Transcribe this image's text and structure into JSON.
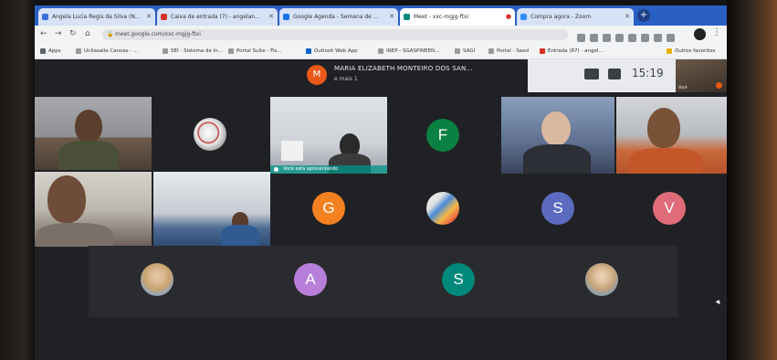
{
  "tabs": [
    {
      "label": "Angela Lucia Regis da Silva (N...",
      "favicon": "#3b6fd8",
      "active": false
    },
    {
      "label": "Caixa de entrada (7) - angelan...",
      "favicon": "#d93025",
      "active": false
    },
    {
      "label": "Google Agenda - Semana de ...",
      "favicon": "#1a73e8",
      "active": false
    },
    {
      "label": "Meet ‑ xxc‑mgjg‑ftxi",
      "favicon": "#00897b",
      "active": true
    },
    {
      "label": "Compra agora - Zoom",
      "favicon": "#2d8cff",
      "active": false
    }
  ],
  "new_tab_label": "+",
  "address_bar": {
    "url": "meet.google.com/xxc-mgjg-ftxi"
  },
  "bookmarks": [
    {
      "label": "Apps",
      "icon": "apps-icon"
    },
    {
      "label": "Unilasalle Canoas - ...",
      "icon": "bookmark-icon"
    },
    {
      "label": "SEI - Sistema de In...",
      "icon": "bookmark-icon"
    },
    {
      "label": "Portal Suite - Fis...",
      "icon": "bookmark-icon"
    },
    {
      "label": "Outlook Web App",
      "icon": "outlook-icon"
    },
    {
      "label": "INEP - SGASPINEEN...",
      "icon": "bookmark-icon"
    },
    {
      "label": "SAGI",
      "icon": "bookmark-icon"
    },
    {
      "label": "Portal - Seed",
      "icon": "bookmark-icon"
    },
    {
      "label": "Entrada (87) - angel...",
      "icon": "gmail-icon"
    },
    {
      "label": "Outros favoritos",
      "icon": "folder-icon"
    }
  ],
  "presenter": {
    "initial": "M",
    "name": "MARIA ELIZABETH MONTEIRO DOS SAN...",
    "more": "e mais 1"
  },
  "clock": "15:19",
  "self_view_label": "Você",
  "video_tiles": [
    {
      "id": "participant-video-1",
      "name_tag": ""
    },
    {
      "id": "participant-video-2",
      "name_tag": "Você está apresentando"
    },
    {
      "id": "participant-video-3",
      "name_tag": ""
    },
    {
      "id": "participant-video-4",
      "name_tag": ""
    },
    {
      "id": "participant-video-5",
      "name_tag": ""
    },
    {
      "id": "participant-video-6",
      "name_tag": ""
    }
  ],
  "avatars": [
    {
      "initial": "F",
      "color": "#0b8043"
    },
    {
      "initial": "G",
      "color": "#f4811f"
    },
    {
      "initial": "S",
      "color": "#5c6bc0"
    },
    {
      "initial": "V",
      "color": "#e06b7a"
    },
    {
      "initial": "A",
      "color": "#b77fd9"
    },
    {
      "initial": "S",
      "color": "#00897b"
    }
  ]
}
